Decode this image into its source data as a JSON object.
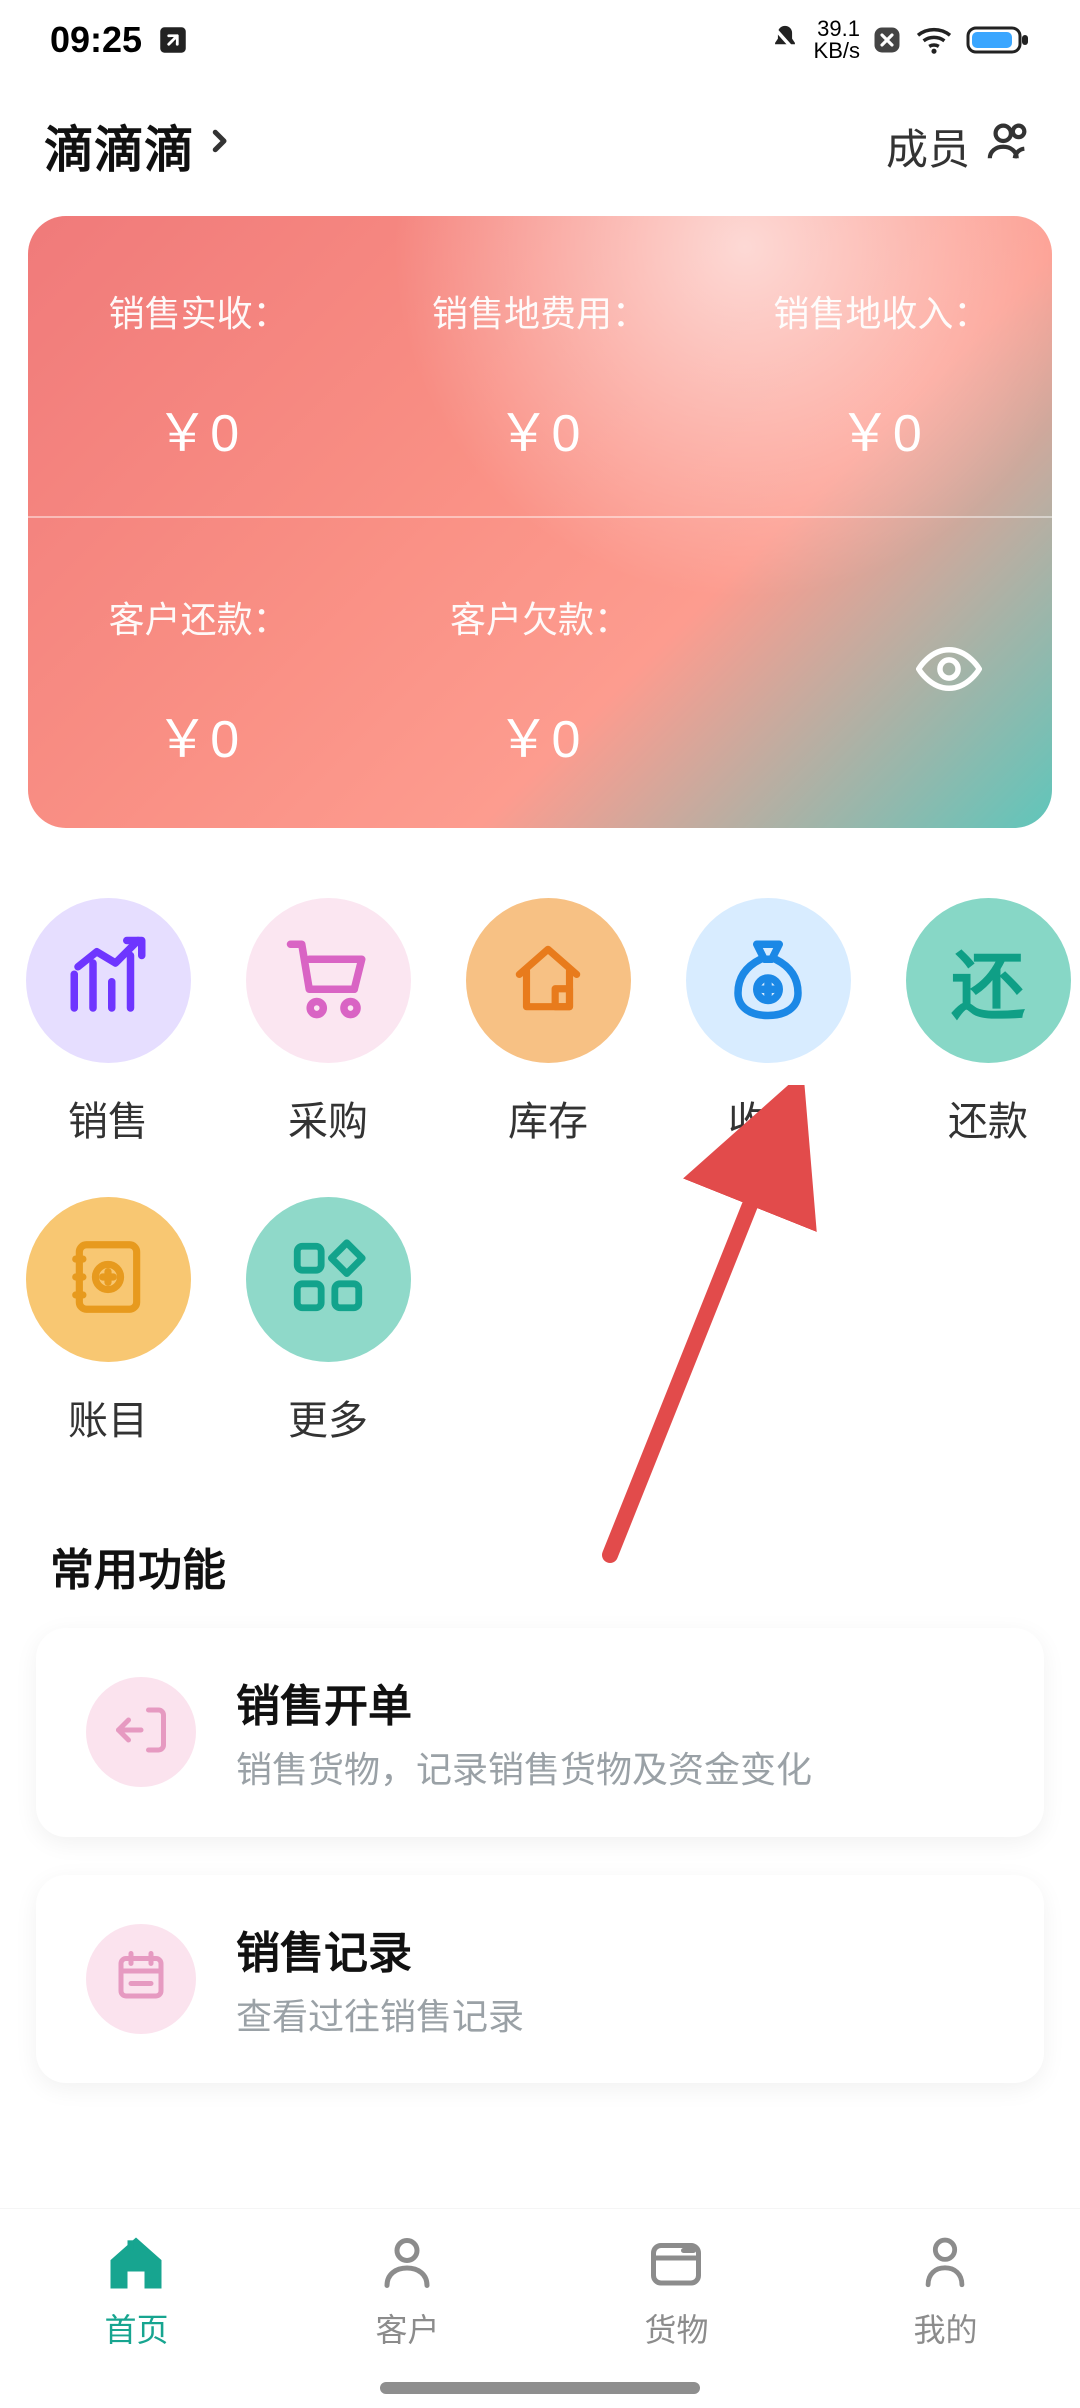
{
  "status": {
    "time": "09:25",
    "net_speed": "39.1",
    "net_unit": "KB/s"
  },
  "header": {
    "title": "滴滴滴",
    "members_label": "成员"
  },
  "summary": {
    "cells": [
      {
        "label": "销售实收：",
        "value": "￥0"
      },
      {
        "label": "销售地费用：",
        "value": "￥0"
      },
      {
        "label": "销售地收入：",
        "value": "￥0"
      },
      {
        "label": "客户还款：",
        "value": "￥0"
      },
      {
        "label": "客户欠款：",
        "value": "￥0"
      }
    ]
  },
  "actions": [
    {
      "key": "sales",
      "label": "销售",
      "bg": "#e6deff",
      "icon": "chart",
      "fg": "#6e35ff"
    },
    {
      "key": "purchase",
      "label": "采购",
      "bg": "#fbe6f1",
      "icon": "cart",
      "fg": "#d964c4"
    },
    {
      "key": "stock",
      "label": "库存",
      "bg": "#f7c184",
      "icon": "house",
      "fg": "#e87b1c"
    },
    {
      "key": "io",
      "label": "收支",
      "bg": "#d8ecff",
      "icon": "bag",
      "fg": "#1b88e6"
    },
    {
      "key": "repay",
      "label": "还款",
      "bg": "#87d7c6",
      "icon": "text",
      "fg": "#0f9f86",
      "text": "还"
    },
    {
      "key": "ledger",
      "label": "账目",
      "bg": "#f8c772",
      "icon": "ledger",
      "fg": "#e79a1e"
    },
    {
      "key": "more",
      "label": "更多",
      "bg": "#8fd9c9",
      "icon": "grid",
      "fg": "#12a38c"
    }
  ],
  "section": {
    "common_title": "常用功能"
  },
  "functions": [
    {
      "key": "sales-create",
      "title": "销售开单",
      "desc": "销售货物，记录销售货物及资金变化",
      "icon_bg": "#fbe3ee",
      "icon_fg": "#e69ac1",
      "icon": "exit"
    },
    {
      "key": "sales-history",
      "title": "销售记录",
      "desc": "查看过往销售记录",
      "icon_bg": "#fbe3ee",
      "icon_fg": "#e69ac1",
      "icon": "calendar"
    }
  ],
  "nav": {
    "items": [
      {
        "key": "home",
        "label": "首页",
        "active": true
      },
      {
        "key": "customer",
        "label": "客户",
        "active": false
      },
      {
        "key": "goods",
        "label": "货物",
        "active": false
      },
      {
        "key": "mine",
        "label": "我的",
        "active": false
      }
    ]
  }
}
